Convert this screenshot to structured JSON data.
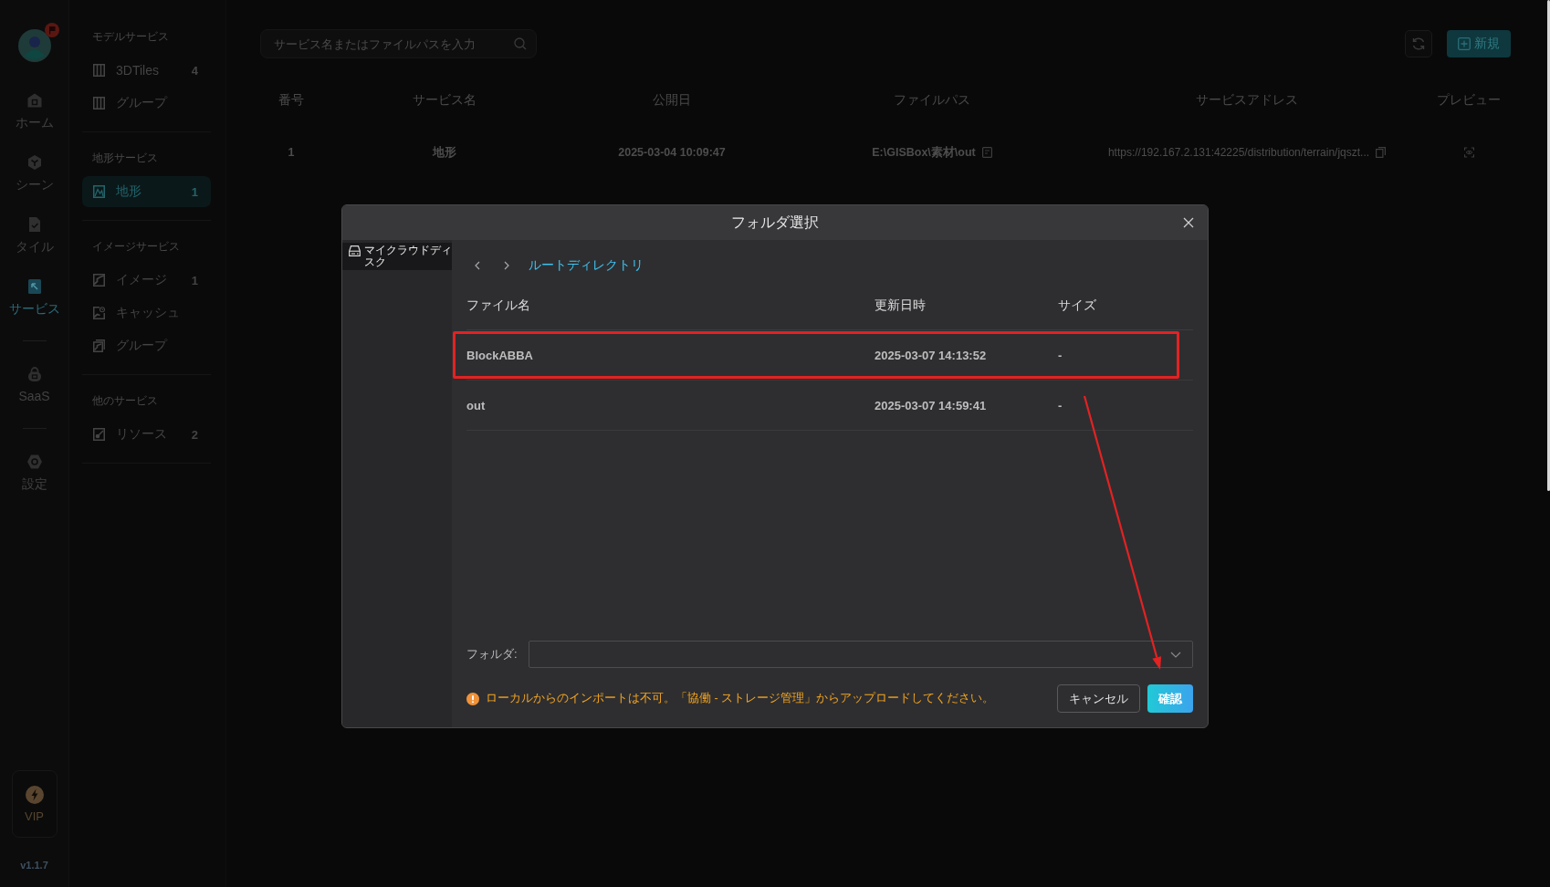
{
  "nav_rail": {
    "groups": [
      {
        "items": [
          {
            "label": "ホーム",
            "selected": false
          },
          {
            "label": "シーン",
            "selected": false
          },
          {
            "label": "タイル",
            "selected": false
          },
          {
            "label": "サービス",
            "selected": true
          }
        ]
      },
      {
        "items": [
          {
            "label": "SaaS",
            "selected": false
          }
        ]
      },
      {
        "items": [
          {
            "label": "設定",
            "selected": false
          }
        ]
      }
    ],
    "vip": {
      "label": "VIP"
    },
    "version": "v1.1.7"
  },
  "sidebar": {
    "sections": [
      {
        "title": "モデルサービス",
        "items": [
          {
            "label": "3DTiles",
            "count": "4",
            "selected": false
          },
          {
            "label": "グループ",
            "selected": false
          }
        ]
      },
      {
        "title": "地形サービス",
        "items": [
          {
            "label": "地形",
            "count": "1",
            "selected": true
          }
        ]
      },
      {
        "title": "イメージサービス",
        "items": [
          {
            "label": "イメージ",
            "count": "1",
            "selected": false
          },
          {
            "label": "キャッシュ",
            "selected": false
          },
          {
            "label": "グループ",
            "selected": false
          }
        ]
      },
      {
        "title": "他のサービス",
        "items": [
          {
            "label": "リソース",
            "count": "2",
            "selected": false
          }
        ]
      }
    ]
  },
  "toolbar": {
    "search": {
      "placeholder": "サービス名またはファイルパスを入力"
    },
    "new_button": "新規"
  },
  "table": {
    "columns": [
      "番号",
      "サービス名",
      "公開日",
      "ファイルパス",
      "サービスアドレス",
      "プレビュー"
    ],
    "rows": [
      {
        "number": "1",
        "name": "地形",
        "published": "2025-03-04 10:09:47",
        "file_path": "E:\\GISBox\\素材\\out",
        "address": "https://192.167.2.131:42225/distribution/terrain/jqszt..."
      }
    ]
  },
  "dialog": {
    "title": "フォルダ選択",
    "sidebar": [
      {
        "label": "マイクラウドディスク",
        "selected": true
      }
    ],
    "breadcrumb": "ルートディレクトリ",
    "columns": [
      "ファイル名",
      "更新日時",
      "サイズ"
    ],
    "rows": [
      {
        "name": "BlockABBA",
        "modified": "2025-03-07 14:13:52",
        "size": "-",
        "highlighted": true
      },
      {
        "name": "out",
        "modified": "2025-03-07 14:59:41",
        "size": "-",
        "highlighted": false
      }
    ],
    "folder_field": {
      "label": "フォルダ:"
    },
    "warning": "ローカルからのインポートは不可。「協働 - ストレージ管理」からアップロードしてください。",
    "buttons": [
      {
        "label": "キャンセル",
        "kind": "secondary"
      },
      {
        "label": "確認",
        "kind": "primary"
      }
    ]
  }
}
